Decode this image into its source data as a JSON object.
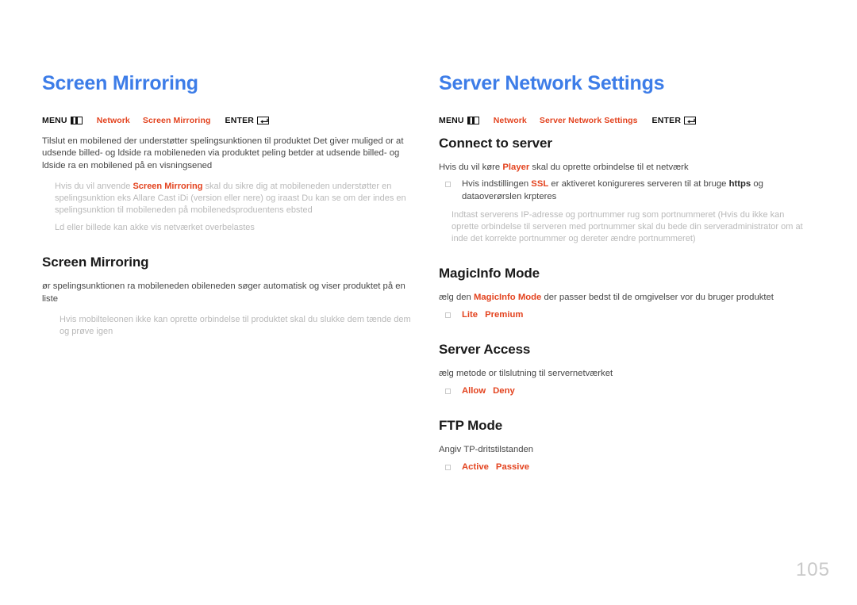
{
  "document": {
    "page_number": "105",
    "accent_blue": "#3d7de8",
    "accent_orange": "#e3431f",
    "body_color": "#464646",
    "note_color": "#b9b9b9"
  },
  "left_column": {
    "title": "Screen Mirroring",
    "menu_path": {
      "menu_label": "MENU",
      "menu_icon": "menu-grid-icon",
      "item1": "Network",
      "item2": "Screen Mirroring",
      "enter_label": "ENTER",
      "enter_icon": "enter-return-icon"
    },
    "intro": "Tilslut en mobilened der understøtter spelingsunktionen til produktet Det giver muliged or at udsende billed- og ldside ra mobileneden via produktet peling betder at udsende billed- og ldside ra en mobilened på en visningsened",
    "note1_pre": "Hvis du vil anvende ",
    "note1_hl": "Screen Mirroring",
    "note1_post": " skal du sikre dig at mobileneden understøtter en spelingsunktion eks Allare Cast iDi (version  eller nere) og iraast Du kan se om der indes en spelingsunktion til mobileneden på mobilenedsproduentens ebsted",
    "note2": "Ld eller billede kan akke vis netværket overbelastes",
    "section": {
      "heading": "Screen Mirroring",
      "body": "ør spelingsunktionen ra mobileneden obileneden søger automatisk og viser produktet på en liste",
      "note": "Hvis mobilteleonen ikke kan oprette orbindelse til produktet skal du slukke dem tænde dem og prøve igen"
    }
  },
  "right_column": {
    "title": "Server Network Settings",
    "menu_path": {
      "menu_label": "MENU",
      "menu_icon": "menu-grid-icon",
      "item1": "Network",
      "item2": "Server Network Settings",
      "enter_label": "ENTER",
      "enter_icon": "enter-return-icon"
    },
    "sections": [
      {
        "heading": "Connect to server",
        "body_pre": "Hvis du vil køre ",
        "body_hl": "Player",
        "body_post": " skal du oprette orbindelse til et netværk",
        "bullet_pre": "Hvis indstillingen ",
        "bullet_hl": "SSL",
        "bullet_mid": " er aktiveret konigureres serveren til at bruge ",
        "bullet_bold": "https",
        "bullet_post": " og dataoverørslen krpteres",
        "note": "Indtast serverens IP-adresse og portnummer rug  som portnummeret (Hvis du ikke kan oprette orbindelse til serveren med portnummer  skal du bede din serveradministrator om at inde det korrekte portnummer og dereter ændre portnummeret)"
      },
      {
        "heading": "MagicInfo Mode",
        "body_pre": "ælg den ",
        "body_hl": "MagicInfo Mode",
        "body_post": " der passer bedst til de omgivelser vor du bruger produktet",
        "options": [
          "Lite",
          "Premium"
        ]
      },
      {
        "heading": "Server Access",
        "body": "ælg metode or tilslutning til servernetværket",
        "options": [
          "Allow",
          "Deny"
        ]
      },
      {
        "heading": "FTP Mode",
        "body": "Angiv TP-dritstilstanden",
        "options": [
          "Active",
          "Passive"
        ]
      }
    ]
  }
}
